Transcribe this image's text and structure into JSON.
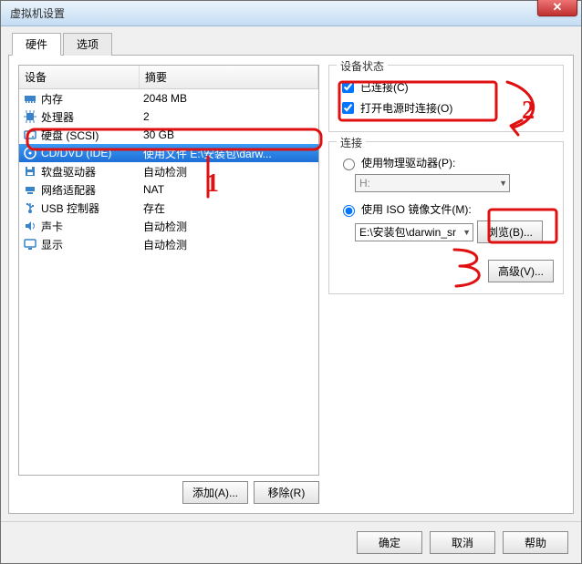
{
  "window": {
    "title": "虚拟机设置"
  },
  "tabs": {
    "hardware": "硬件",
    "options": "选项"
  },
  "hwlist": {
    "col_device": "设备",
    "col_summary": "摘要",
    "rows": [
      {
        "icon": "memory-icon",
        "device": "内存",
        "summary": "2048 MB",
        "selected": false
      },
      {
        "icon": "cpu-icon",
        "device": "处理器",
        "summary": "2",
        "selected": false
      },
      {
        "icon": "hdd-icon",
        "device": "硬盘 (SCSI)",
        "summary": "30 GB",
        "selected": false
      },
      {
        "icon": "cd-icon",
        "device": "CD/DVD (IDE)",
        "summary": "使用文件 E:\\安装包\\darw...",
        "selected": true
      },
      {
        "icon": "floppy-icon",
        "device": "软盘驱动器",
        "summary": "自动检测",
        "selected": false
      },
      {
        "icon": "net-icon",
        "device": "网络适配器",
        "summary": "NAT",
        "selected": false
      },
      {
        "icon": "usb-icon",
        "device": "USB 控制器",
        "summary": "存在",
        "selected": false
      },
      {
        "icon": "sound-icon",
        "device": "声卡",
        "summary": "自动检测",
        "selected": false
      },
      {
        "icon": "display-icon",
        "device": "显示",
        "summary": "自动检测",
        "selected": false
      }
    ]
  },
  "left_buttons": {
    "add": "添加(A)...",
    "remove": "移除(R)"
  },
  "status_group": {
    "legend": "设备状态",
    "connected": "已连接(C)",
    "connect_on_power": "打开电源时连接(O)"
  },
  "connection_group": {
    "legend": "连接",
    "use_physical": "使用物理驱动器(P):",
    "physical_value": "H:",
    "use_iso": "使用 ISO 镜像文件(M):",
    "iso_path": "E:\\安装包\\darwin_sr",
    "browse": "浏览(B)...",
    "advanced": "高级(V)..."
  },
  "footer": {
    "ok": "确定",
    "cancel": "取消",
    "help": "帮助"
  },
  "annotations": {
    "one": "1",
    "two": "2",
    "three": "3"
  }
}
